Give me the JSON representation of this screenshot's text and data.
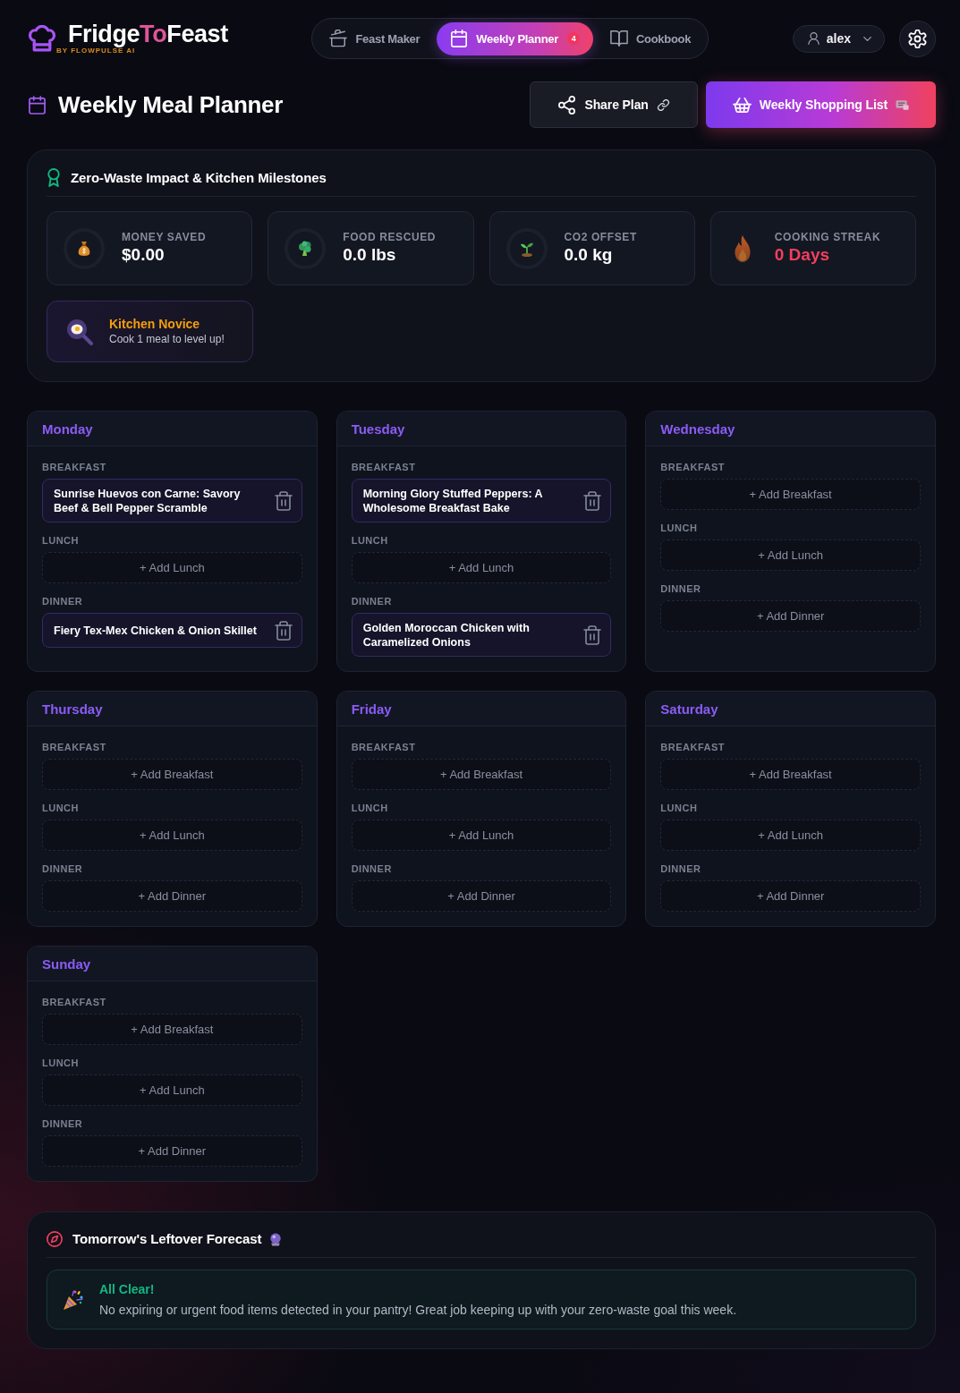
{
  "header": {
    "logo": {
      "parts": [
        {
          "text": "Fridge",
          "highlight": false
        },
        {
          "text": "To",
          "highlight": true
        },
        {
          "text": "Feast",
          "highlight": false
        }
      ],
      "tagline": "BY FLOWPULSE AI"
    },
    "nav": [
      {
        "label": "Feast Maker",
        "selected": false
      },
      {
        "label": "Weekly Planner",
        "selected": true,
        "badge": "4"
      },
      {
        "label": "Cookbook",
        "selected": false
      }
    ],
    "user": {
      "name": "alex"
    }
  },
  "page_title": "Weekly Meal Planner",
  "actions": [
    {
      "label": "Share Plan",
      "kind": "secondary"
    },
    {
      "label": "Weekly Shopping List",
      "kind": "primary"
    }
  ],
  "impact": {
    "title": "Zero-Waste Impact & Kitchen Milestones",
    "stats": [
      {
        "kind": "ring",
        "label": "MONEY SAVED",
        "value": "$0.00"
      },
      {
        "kind": "ring",
        "label": "FOOD RESCUED",
        "value": "0.0 lbs"
      },
      {
        "kind": "ring",
        "label": "CO2 OFFSET",
        "value": "0.0 kg"
      },
      {
        "kind": "streak",
        "label": "COOKING STREAK",
        "value": "0 Days"
      }
    ],
    "milestone": {
      "title": "Kitchen Novice",
      "hint": "Cook 1 meal to level up!"
    }
  },
  "days": [
    {
      "name": "Monday",
      "meals": [
        {
          "label": "BREAKFAST",
          "kind": "recipe",
          "text": "Sunrise Huevos con Carne: Savory Beef & Bell Pepper Scramble"
        },
        {
          "label": "LUNCH",
          "kind": "empty",
          "text": "+ Add Lunch"
        },
        {
          "label": "DINNER",
          "kind": "recipe",
          "text": "Fiery Tex-Mex Chicken & Onion Skillet"
        }
      ]
    },
    {
      "name": "Tuesday",
      "meals": [
        {
          "label": "BREAKFAST",
          "kind": "recipe",
          "text": "Morning Glory Stuffed Peppers: A Wholesome Breakfast Bake"
        },
        {
          "label": "LUNCH",
          "kind": "empty",
          "text": "+ Add Lunch"
        },
        {
          "label": "DINNER",
          "kind": "recipe",
          "text": "Golden Moroccan Chicken with Caramelized Onions"
        }
      ]
    },
    {
      "name": "Wednesday",
      "meals": [
        {
          "label": "BREAKFAST",
          "kind": "empty",
          "text": "+ Add Breakfast"
        },
        {
          "label": "LUNCH",
          "kind": "empty",
          "text": "+ Add Lunch"
        },
        {
          "label": "DINNER",
          "kind": "empty",
          "text": "+ Add Dinner"
        }
      ]
    },
    {
      "name": "Thursday",
      "meals": [
        {
          "label": "BREAKFAST",
          "kind": "empty",
          "text": "+ Add Breakfast"
        },
        {
          "label": "LUNCH",
          "kind": "empty",
          "text": "+ Add Lunch"
        },
        {
          "label": "DINNER",
          "kind": "empty",
          "text": "+ Add Dinner"
        }
      ]
    },
    {
      "name": "Friday",
      "meals": [
        {
          "label": "BREAKFAST",
          "kind": "empty",
          "text": "+ Add Breakfast"
        },
        {
          "label": "LUNCH",
          "kind": "empty",
          "text": "+ Add Lunch"
        },
        {
          "label": "DINNER",
          "kind": "empty",
          "text": "+ Add Dinner"
        }
      ]
    },
    {
      "name": "Saturday",
      "meals": [
        {
          "label": "BREAKFAST",
          "kind": "empty",
          "text": "+ Add Breakfast"
        },
        {
          "label": "LUNCH",
          "kind": "empty",
          "text": "+ Add Lunch"
        },
        {
          "label": "DINNER",
          "kind": "empty",
          "text": "+ Add Dinner"
        }
      ]
    },
    {
      "name": "Sunday",
      "meals": [
        {
          "label": "BREAKFAST",
          "kind": "empty",
          "text": "+ Add Breakfast"
        },
        {
          "label": "LUNCH",
          "kind": "empty",
          "text": "+ Add Lunch"
        },
        {
          "label": "DINNER",
          "kind": "empty",
          "text": "+ Add Dinner"
        }
      ]
    }
  ],
  "forecast": {
    "title": "Tomorrow's Leftover Forecast",
    "status": {
      "title": "All Clear!",
      "message": "No expiring or urgent food items detected in your pantry! Great job keeping up with your zero-waste goal this week."
    }
  }
}
